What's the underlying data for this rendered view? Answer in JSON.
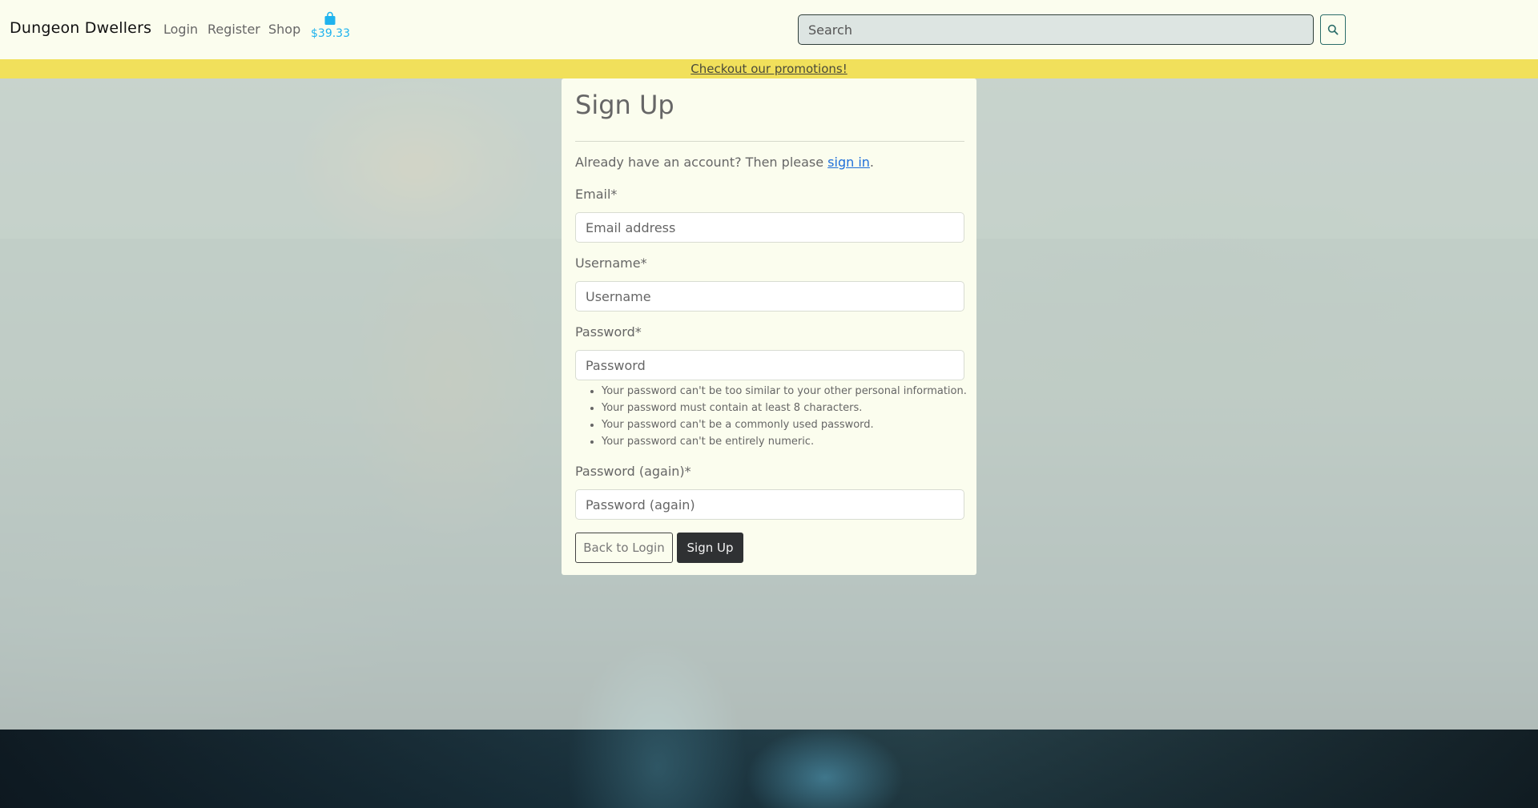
{
  "navbar": {
    "brand": "Dungeon Dwellers",
    "links": [
      "Login",
      "Register",
      "Shop"
    ],
    "cart_total": "$39.33",
    "search_placeholder": "Search"
  },
  "promo": {
    "text": "Checkout our promotions!"
  },
  "signup": {
    "title": "Sign Up",
    "intro_prefix": "Already have an account? Then please ",
    "intro_link": "sign in",
    "intro_suffix": ".",
    "fields": {
      "email": {
        "label": "Email*",
        "placeholder": "Email address"
      },
      "username": {
        "label": "Username*",
        "placeholder": "Username"
      },
      "password": {
        "label": "Password*",
        "placeholder": "Password"
      },
      "password2": {
        "label": "Password (again)*",
        "placeholder": "Password (again)"
      }
    },
    "password_help": [
      "Your password can't be too similar to your other personal information.",
      "Your password must contain at least 8 characters.",
      "Your password can't be a commonly used password.",
      "Your password can't be entirely numeric."
    ],
    "back_button": "Back to Login",
    "submit_button": "Sign Up"
  },
  "colors": {
    "navbar_bg": "#fbfdee",
    "promo_bg": "#f1e05b",
    "cart_accent": "#1fb3ee",
    "link_blue": "#1f6fd9",
    "primary_button": "#2f3133"
  },
  "icons": {
    "cart": "shopping-bag-icon",
    "search": "search-icon"
  }
}
